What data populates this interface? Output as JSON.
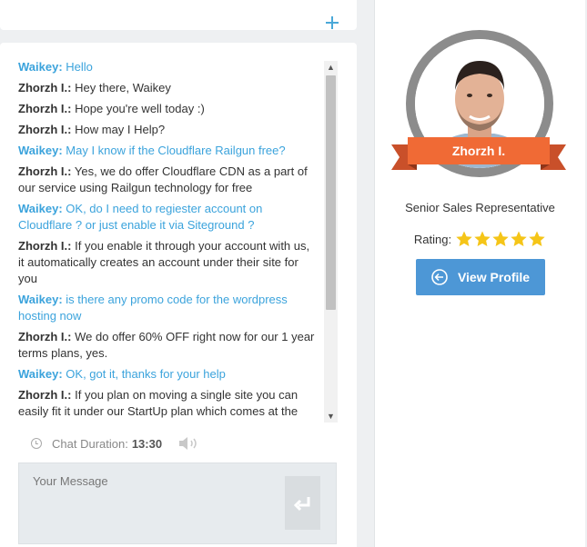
{
  "messages": [
    {
      "speaker": "Waikey:",
      "text": "Hello",
      "role": "user"
    },
    {
      "speaker": "Zhorzh I.:",
      "text": "Hey there, Waikey",
      "role": "agent"
    },
    {
      "speaker": "Zhorzh I.:",
      "text": "Hope you're well today :)",
      "role": "agent"
    },
    {
      "speaker": "Zhorzh I.:",
      "text": "How may I Help?",
      "role": "agent"
    },
    {
      "speaker": "Waikey:",
      "text": "May I know if the Cloudflare Railgun free?",
      "role": "user"
    },
    {
      "speaker": "Zhorzh I.:",
      "text": "Yes, we do offer Cloudflare CDN as a part of our service using Railgun technology for free",
      "role": "agent"
    },
    {
      "speaker": "Waikey:",
      "text": "OK, do I need to regiester account on Cloudflare ? or just enable it via Siteground ?",
      "role": "user"
    },
    {
      "speaker": "Zhorzh I.:",
      "text": "If you enable it through your account with us, it automatically creates an account under their site for you",
      "role": "agent"
    },
    {
      "speaker": "Waikey:",
      "text": "is there any promo code for the wordpress hosting now",
      "role": "user"
    },
    {
      "speaker": "Zhorzh I.:",
      "text": "We do offer 60% OFF right now for our 1 year terms plans, yes.",
      "role": "agent"
    },
    {
      "speaker": "Waikey:",
      "text": "OK, got it, thanks for your help",
      "role": "user"
    },
    {
      "speaker": "Zhorzh I.:",
      "text": "If you plan on moving a single site you can easily fit it under our StartUp plan which comes at the",
      "role": "agent"
    }
  ],
  "duration": {
    "label": "Chat Duration:",
    "value": "13:30"
  },
  "composer": {
    "placeholder": "Your Message"
  },
  "profile": {
    "name": "Zhorzh I.",
    "role": "Senior Sales Representative",
    "rating_label": "Rating:",
    "rating": 5,
    "button_label": "View Profile"
  },
  "colors": {
    "user_text": "#3ba3dc",
    "ribbon": "#f06a35",
    "button": "#4d97d6",
    "star": "#f5c518"
  }
}
